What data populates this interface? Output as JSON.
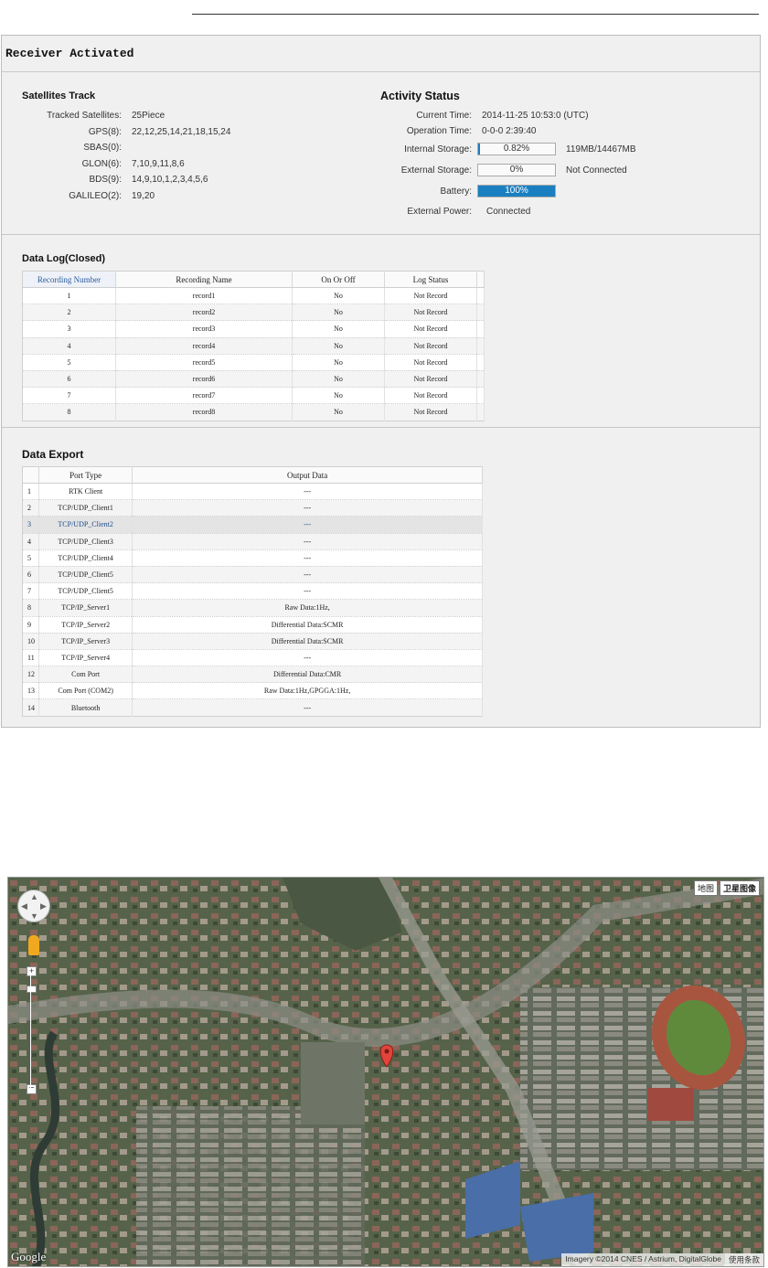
{
  "panel": {
    "title": "Receiver Activated"
  },
  "satellites": {
    "heading": "Satellites Track",
    "rows": [
      {
        "label": "Tracked Satellites:",
        "value": "25Piece"
      },
      {
        "label": "GPS(8):",
        "value": "22,12,25,14,21,18,15,24"
      },
      {
        "label": "SBAS(0):",
        "value": ""
      },
      {
        "label": "GLON(6):",
        "value": "7,10,9,11,8,6"
      },
      {
        "label": "BDS(9):",
        "value": "14,9,10,1,2,3,4,5,6"
      },
      {
        "label": "GALILEO(2):",
        "value": "19,20"
      }
    ]
  },
  "activity": {
    "heading": "Activity Status",
    "current_time_label": "Current Time:",
    "current_time": "2014-11-25 10:53:0 (UTC)",
    "operation_time_label": "Operation Time:",
    "operation_time": "0-0-0 2:39:40",
    "internal_label": "Internal Storage:",
    "internal_text": "0.82%",
    "internal_fraction": 0.0082,
    "internal_size": "119MB/14467MB",
    "external_label": "External Storage:",
    "external_text": "0%",
    "external_fraction": 0,
    "external_status": "Not Connected",
    "battery_label": "Battery:",
    "battery_text": "100%",
    "battery_fraction": 1.0,
    "power_label": "External Power:",
    "power_value": "Connected",
    "bar_color": "#1a7fc1"
  },
  "datalog": {
    "heading": "Data Log(Closed)",
    "columns": [
      "Recording Number",
      "Recording Name",
      "On Or Off",
      "Log Status"
    ],
    "rows": [
      [
        "1",
        "record1",
        "No",
        "Not Record"
      ],
      [
        "2",
        "record2",
        "No",
        "Not Record"
      ],
      [
        "3",
        "record3",
        "No",
        "Not Record"
      ],
      [
        "4",
        "record4",
        "No",
        "Not Record"
      ],
      [
        "5",
        "record5",
        "No",
        "Not Record"
      ],
      [
        "6",
        "record6",
        "No",
        "Not Record"
      ],
      [
        "7",
        "record7",
        "No",
        "Not Record"
      ],
      [
        "8",
        "record8",
        "No",
        "Not Record"
      ]
    ]
  },
  "export": {
    "heading": "Data Export",
    "columns": [
      "",
      "Port Type",
      "Output Data"
    ],
    "rows": [
      [
        "1",
        "RTK Client",
        "---"
      ],
      [
        "2",
        "TCP/UDP_Client1",
        "---"
      ],
      [
        "3",
        "TCP/UDP_Client2",
        "---"
      ],
      [
        "4",
        "TCP/UDP_Client3",
        "---"
      ],
      [
        "5",
        "TCP/UDP_Client4",
        "---"
      ],
      [
        "6",
        "TCP/UDP_Client5",
        "---"
      ],
      [
        "7",
        "TCP/UDP_Client5",
        "---"
      ],
      [
        "8",
        "TCP/IP_Server1",
        "Raw Data:1Hz,"
      ],
      [
        "9",
        "TCP/IP_Server2",
        "Differential Data:SCMR"
      ],
      [
        "10",
        "TCP/IP_Server3",
        "Differential Data:SCMR"
      ],
      [
        "11",
        "TCP/IP_Server4",
        "---"
      ],
      [
        "12",
        "Com Port",
        "Differential Data:CMR"
      ],
      [
        "13",
        "Com Port (COM2)",
        "Raw Data:1Hz,GPGGA:1Hz,"
      ],
      [
        "14",
        "Bluetooth",
        "---"
      ]
    ],
    "selected_row": 2
  },
  "map": {
    "type_map": "地图",
    "type_satellite": "卫星图像",
    "logo": "Google",
    "attribution": "Imagery ©2014 CNES / Astrium, DigitalGlobe",
    "terms": "使用条款",
    "colors": {
      "vegetation": "#4f5e45",
      "roofs_red": "#9a5a4a",
      "track": "#a8553f",
      "field": "#5f8a3c",
      "water": "#3b4a44",
      "blue_roof": "#4a6ea8",
      "marker": "#e0443a"
    }
  }
}
